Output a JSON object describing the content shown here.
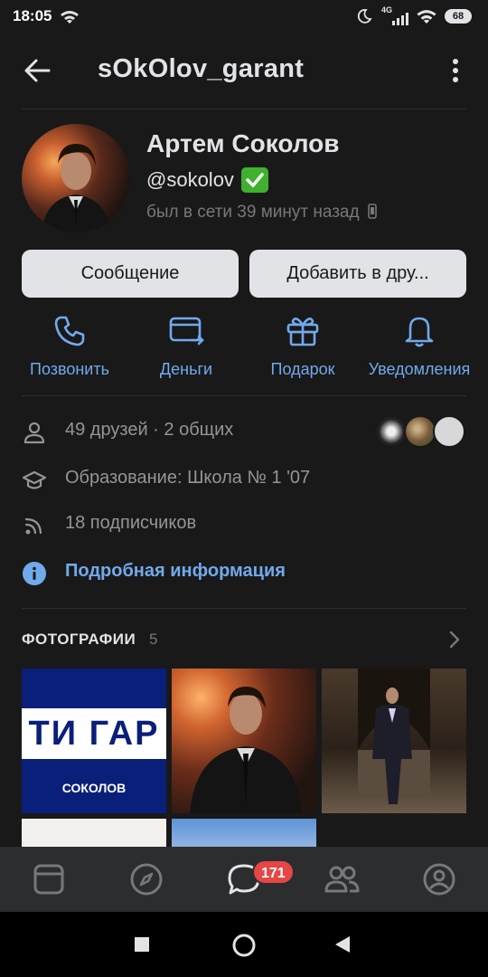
{
  "status_bar": {
    "time": "18:05",
    "battery": "68",
    "network": "4G"
  },
  "header": {
    "title": "sOkOlov_garant"
  },
  "profile": {
    "name": "Артем Соколов",
    "handle": "@sokolov",
    "last_seen": "был в сети 39 минут назад"
  },
  "buttons": {
    "message": "Сообщение",
    "add_friend": "Добавить в дру..."
  },
  "actions": [
    {
      "label": "Позвонить",
      "icon": "phone-icon"
    },
    {
      "label": "Деньги",
      "icon": "money-icon"
    },
    {
      "label": "Подарок",
      "icon": "gift-icon"
    },
    {
      "label": "Уведомления",
      "icon": "bell-icon"
    }
  ],
  "info": {
    "friends": "49 друзей · 2 общих",
    "education": "Образование: Школа № 1 '07",
    "followers": "18 подписчиков",
    "details_link": "Подробная информация"
  },
  "photos": {
    "title": "ФОТОГРАФИИ",
    "count": "5",
    "poster_big": "ТИ ГАР",
    "poster_small": "СОКОЛОВ"
  },
  "tabbar": {
    "messages_badge": "171"
  },
  "colors": {
    "accent": "#71aaeb",
    "background": "#19191a",
    "badge": "#e64646",
    "verified": "#3fb12f"
  }
}
